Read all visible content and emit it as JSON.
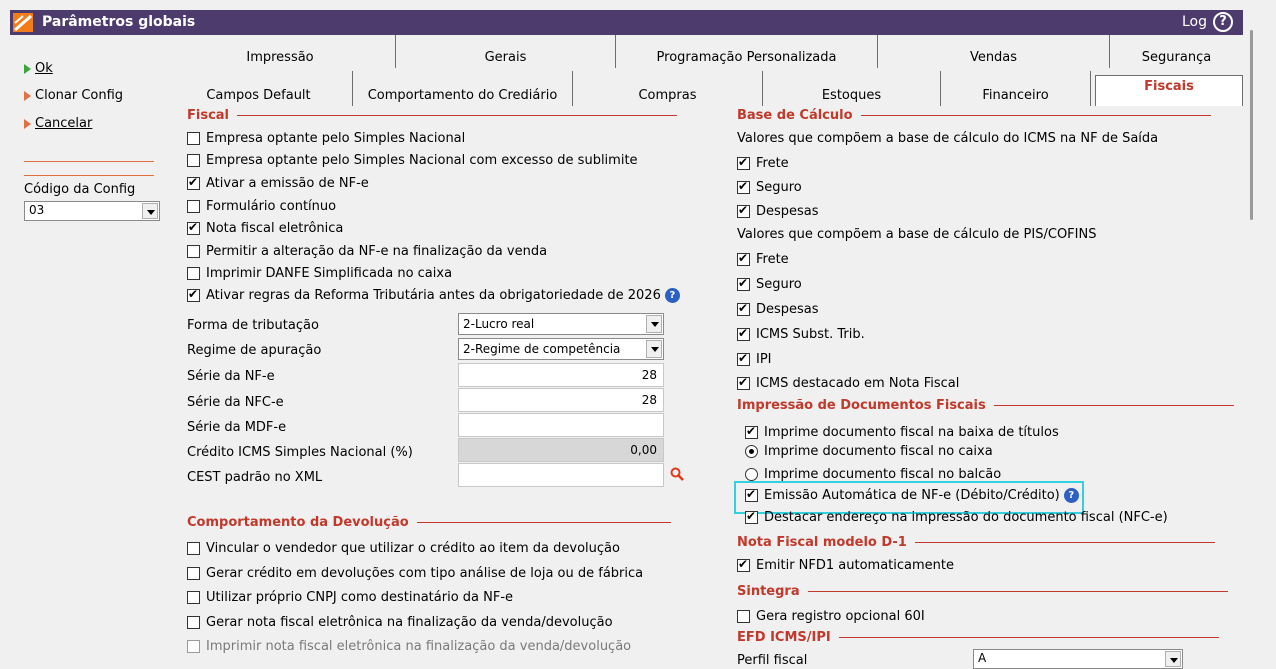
{
  "window": {
    "title": "Parâmetros globais",
    "log_label": "Log",
    "help_glyph": "?"
  },
  "left": {
    "ok": "Ok",
    "clone": "Clonar Config",
    "cancel": "Cancelar",
    "config_label": "Código da Config",
    "config_value": "03"
  },
  "tabs_top": [
    "Impressão",
    "Gerais",
    "Programação Personalizada",
    "Vendas",
    "Segurança"
  ],
  "tabs_bottom": [
    "Campos Default",
    "Comportamento do Crediário",
    "Compras",
    "Estoques",
    "Financeiro",
    "Fiscais"
  ],
  "fiscal": {
    "title": "Fiscal",
    "options": [
      {
        "label": "Empresa optante pelo Simples Nacional",
        "checked": false
      },
      {
        "label": "Empresa optante pelo Simples Nacional com excesso de sublimite",
        "checked": false
      },
      {
        "label": "Ativar a emissão de NF-e",
        "checked": true
      },
      {
        "label": "Formulário contínuo",
        "checked": false
      },
      {
        "label": "Nota fiscal eletrônica",
        "checked": true
      },
      {
        "label": "Permitir a alteração da NF-e na finalização da venda",
        "checked": false
      },
      {
        "label": "Imprimir DANFE Simplificada no caixa",
        "checked": false
      },
      {
        "label": "Ativar regras da Reforma Tributária antes da obrigatoriedade de 2026",
        "checked": true
      }
    ],
    "forma_label": "Forma de tributação",
    "forma_value": "2-Lucro real",
    "regime_label": "Regime de apuração",
    "regime_value": "2-Regime de competência",
    "serie_nfe_label": "Série da NF-e",
    "serie_nfe_value": "28",
    "serie_nfce_label": "Série da NFC-e",
    "serie_nfce_value": "28",
    "serie_mdfe_label": "Série da MDF-e",
    "serie_mdfe_value": "",
    "credito_label": "Crédito ICMS Simples Nacional (%)",
    "credito_value": "0,00",
    "cest_label": "CEST padrão no XML",
    "cest_value": ""
  },
  "devolucao": {
    "title": "Comportamento da Devolução",
    "options": [
      {
        "label": "Vincular o vendedor que utilizar o crédito ao item da devolução",
        "checked": false,
        "disabled": false
      },
      {
        "label": "Gerar crédito em devoluções com tipo análise de loja ou de fábrica",
        "checked": false,
        "disabled": false
      },
      {
        "label": "Utilizar próprio CNPJ como destinatário da NF-e",
        "checked": false,
        "disabled": false
      },
      {
        "label": "Gerar nota fiscal eletrônica na finalização da venda/devolução",
        "checked": false,
        "disabled": false
      },
      {
        "label": "Imprimir nota fiscal eletrônica na finalização da venda/devolução",
        "checked": false,
        "disabled": true
      }
    ]
  },
  "base_calculo": {
    "title": "Base de Cálculo",
    "icms_caption": "Valores que compõem a base de cálculo do ICMS na NF de Saída",
    "icms_options": [
      {
        "label": "Frete",
        "checked": true
      },
      {
        "label": "Seguro",
        "checked": true
      },
      {
        "label": "Despesas",
        "checked": true
      }
    ],
    "pis_caption": "Valores que compõem a base de cálculo de PIS/COFINS",
    "pis_options": [
      {
        "label": "Frete",
        "checked": true
      },
      {
        "label": "Seguro",
        "checked": true
      },
      {
        "label": "Despesas",
        "checked": true
      },
      {
        "label": "ICMS Subst. Trib.",
        "checked": true
      },
      {
        "label": "IPI",
        "checked": true
      },
      {
        "label": "ICMS destacado em Nota Fiscal",
        "checked": true
      }
    ]
  },
  "impressao": {
    "title": "Impressão de Documentos Fiscais",
    "baixa_label": "Imprime documento fiscal na baixa de títulos",
    "caixa_label": "Imprime documento fiscal no caixa",
    "balcao_label": "Imprime documento fiscal no balcão",
    "emissao_label": "Emissão Automática de NF-e (Débito/Crédito)",
    "endereco_label": "Destacar endereço na impressão do documento fiscal (NFC-e)"
  },
  "d1": {
    "title": "Nota Fiscal modelo D-1",
    "option": "Emitir NFD1 automaticamente"
  },
  "sintegra": {
    "title": "Sintegra",
    "option": "Gera registro opcional 60I"
  },
  "efd": {
    "title": "EFD ICMS/IPI",
    "perfil_label": "Perfil fiscal",
    "perfil_value": "A"
  },
  "colors": {
    "accent": "#c0392b",
    "titlebar": "#4e3b6e",
    "highlight": "#33d0e0",
    "help": "#2d5fc4"
  }
}
